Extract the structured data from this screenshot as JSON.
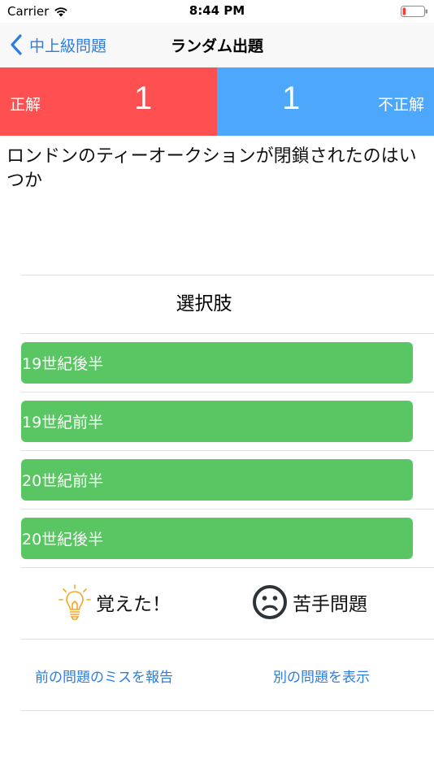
{
  "status_bar": {
    "carrier": "Carrier",
    "time": "8:44 PM",
    "battery_color": "#fe3b30"
  },
  "nav": {
    "back_label": "中上級問題",
    "title": "ランダム出題"
  },
  "score": {
    "correct_label": "正解",
    "correct_count": "1",
    "correct_color": "#fe5050",
    "incorrect_label": "不正解",
    "incorrect_count": "1",
    "incorrect_color": "#4da7fb"
  },
  "question": {
    "text": "ロンドンのティーオークションが閉鎖されたのはいつか"
  },
  "choices": {
    "header": "選択肢",
    "options": [
      "19世紀後半",
      "19世紀前半",
      "20世紀前半",
      "20世紀後半"
    ],
    "button_color": "#5ac563"
  },
  "actions": {
    "memorized_label": "覚えた！",
    "memorized_icon": "lightbulb-icon",
    "difficult_label": "苦手問題",
    "difficult_icon": "sad-face-icon"
  },
  "links": {
    "report_label": "前の問題のミスを報告",
    "another_label": "別の問題を表示"
  }
}
